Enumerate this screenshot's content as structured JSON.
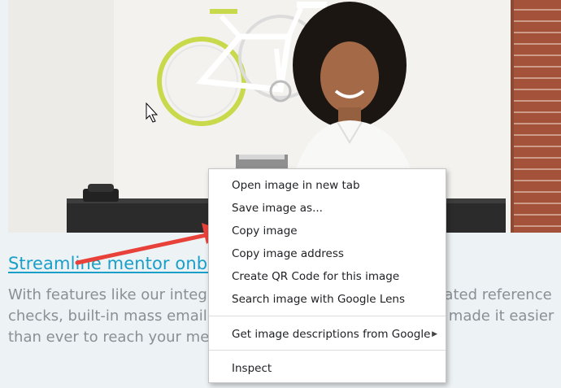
{
  "article": {
    "title": "Streamline mentor onboa",
    "body_lines": [
      "With features like our integrat",
      "checks, built-in mass email &",
      "than ever to reach your mento"
    ],
    "body_right_lines": [
      "nated reference",
      "e made it easier"
    ]
  },
  "context_menu": {
    "items": [
      {
        "label": "Open image in new tab"
      },
      {
        "label": "Save image as..."
      },
      {
        "label": "Copy image"
      },
      {
        "label": "Copy image address"
      },
      {
        "label": "Create QR Code for this image"
      },
      {
        "label": "Search image with Google Lens"
      },
      {
        "label": "Get image descriptions from Google",
        "submenu": true
      },
      {
        "label": "Inspect"
      }
    ],
    "submenu_glyph": "▶"
  },
  "colors": {
    "link": "#1a9fc9",
    "body_text": "#8a8f94",
    "annotation_arrow": "#e8413a",
    "page_background": "#edf2f5"
  }
}
